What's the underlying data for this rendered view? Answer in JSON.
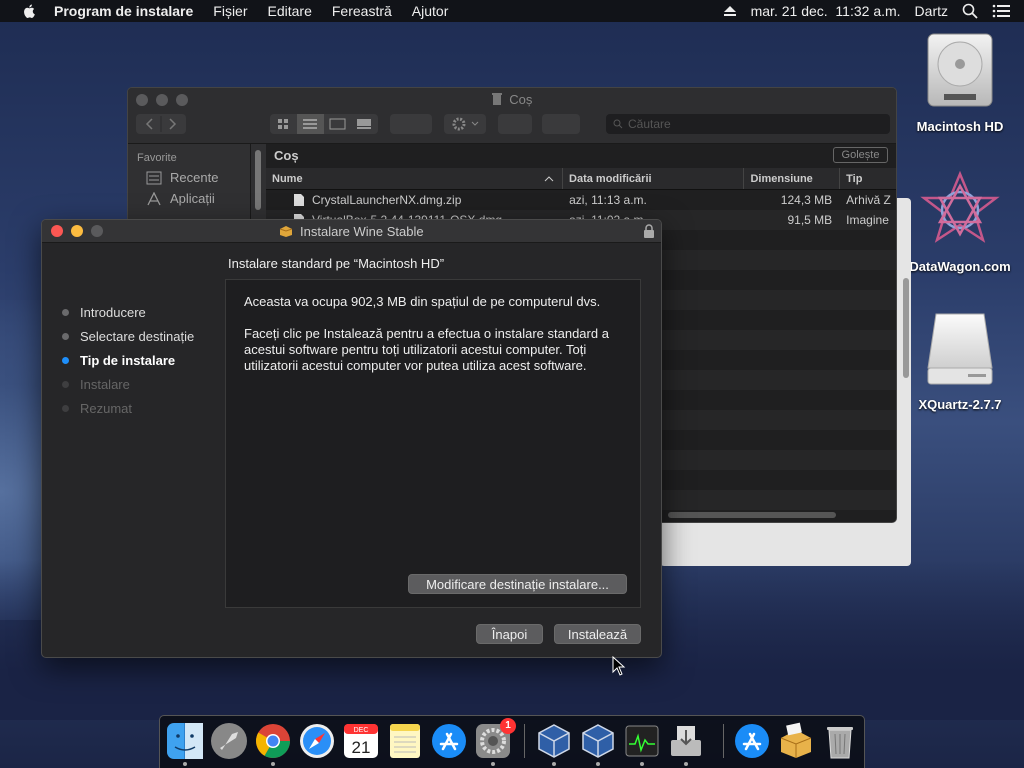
{
  "menubar": {
    "items": [
      "Program de instalare",
      "Fișier",
      "Editare",
      "Fereastră",
      "Ajutor"
    ],
    "datetime": "mar. 21 dec.  11:32 a.m.",
    "user": "Dartz"
  },
  "desktop": {
    "icons": [
      {
        "label": "Macintosh HD"
      },
      {
        "label": "DataWagon.com"
      },
      {
        "label": "XQuartz-2.7.7"
      }
    ]
  },
  "finder": {
    "title": "Coș",
    "search_placeholder": "Căutare",
    "sidebar": {
      "header": "Favorite",
      "items": [
        "Recente",
        "Aplicații"
      ]
    },
    "path": "Coș",
    "empty_button": "Golește",
    "columns": [
      "Nume",
      "Data modificării",
      "Dimensiune",
      "Tip"
    ],
    "rows": [
      {
        "name": "CrystalLauncherNX.dmg.zip",
        "date": "azi, 11:13 a.m.",
        "size": "124,3 MB",
        "kind": "Arhivă Z"
      },
      {
        "name": "VirtualBox-5.2.44-139111-OSX.dmg",
        "date": "azi, 11:02 a.m.",
        "size": "91,5 MB",
        "kind": "Imagine"
      }
    ]
  },
  "installer": {
    "title": "Instalare Wine Stable",
    "heading": "Instalare standard pe “Macintosh HD”",
    "steps": [
      {
        "label": "Introducere",
        "state": "done"
      },
      {
        "label": "Selectare destinație",
        "state": "done"
      },
      {
        "label": "Tip de instalare",
        "state": "active"
      },
      {
        "label": "Instalare",
        "state": "pending"
      },
      {
        "label": "Rezumat",
        "state": "pending"
      }
    ],
    "paragraph1": "Aceasta va ocupa 902,3 MB din spațiul de pe computerul dvs.",
    "paragraph2": "Faceți clic pe Instalează pentru a efectua o instalare standard a acestui software pentru toți utilizatorii acestui computer. Toți utilizatorii acestui computer vor putea utiliza acest software.",
    "change_dest_button": "Modificare destinație instalare...",
    "back_button": "Înapoi",
    "install_button": "Instalează"
  },
  "dock": {
    "apps": [
      "finder-icon",
      "launchpad-icon",
      "chrome-icon",
      "safari-icon",
      "calendar-icon",
      "notes-icon",
      "app-store-icon",
      "system-preferences-icon",
      "virtualbox-icon",
      "virtualbox-vm-icon",
      "activity-monitor-icon",
      "installer-icon",
      "app-store-downloads-icon",
      "package-icon",
      "trash-icon"
    ],
    "calendar_month": "DEC",
    "calendar_day": "21",
    "prefs_badge": "1"
  },
  "colors": {
    "accent": "#1e8ffb",
    "close": "#fc5753",
    "minimize": "#fdbc40"
  }
}
